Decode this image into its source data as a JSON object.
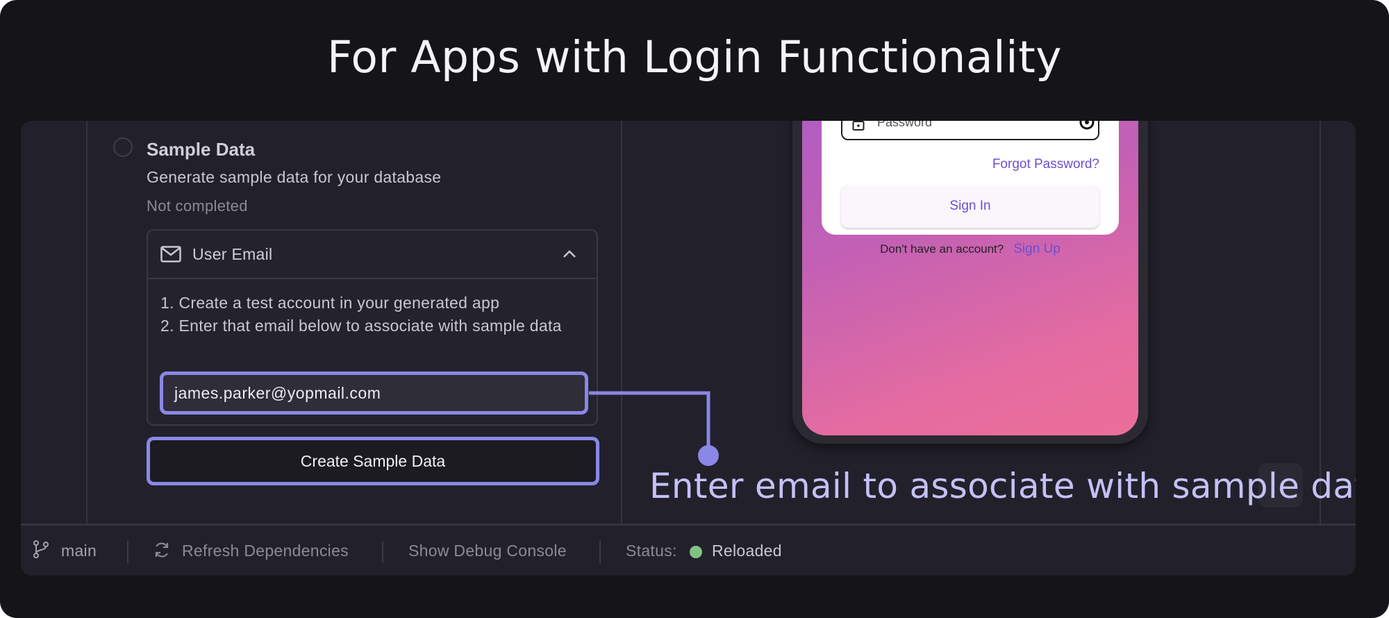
{
  "headline": "For Apps with Login Functionality",
  "step": {
    "title": "Sample Data",
    "description": "Generate sample data for your database",
    "status": "Not completed"
  },
  "email_card": {
    "title": "User Email",
    "instruction_1": "1. Create a test account in your generated app",
    "instruction_2": "2. Enter that email below to associate with sample data",
    "email_value": "james.parker@yopmail.com",
    "icon": "mail-icon",
    "toggle_icon": "chevron-up-icon"
  },
  "create_button": "Create Sample Data",
  "callout": "Enter email to associate with sample data",
  "phone": {
    "password_placeholder": "Password",
    "forgot": "Forgot Password?",
    "sign_in": "Sign In",
    "no_account": "Don't have an account?",
    "sign_up": "Sign Up"
  },
  "statusbar": {
    "branch": "main",
    "refresh": "Refresh Dependencies",
    "debug": "Show Debug Console",
    "status_label": "Status:",
    "status_value": "Reloaded",
    "status_color": "#7fc283"
  },
  "colors": {
    "accent": "#8b87e6",
    "background": "#151419",
    "panel": "#22212b"
  }
}
